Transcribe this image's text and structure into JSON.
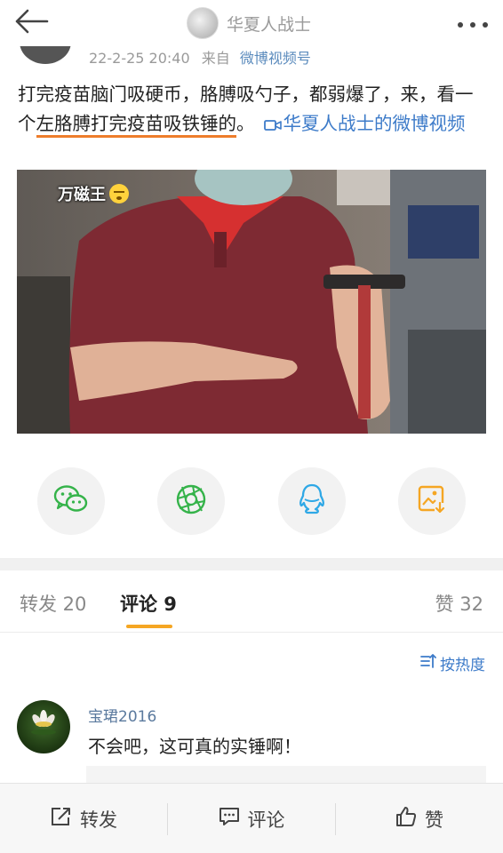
{
  "header": {
    "title": "华夏人战士"
  },
  "post": {
    "meta_time": "22-2-25 20:40",
    "meta_source_prefix": "来自",
    "meta_source": "微博视频号",
    "text_part1": "打完疫苗脑门吸硬币，胳膊吸勺子，都弱爆了，来，看一个",
    "text_underlined": "左胳膊打完疫苗吸铁锤的",
    "text_part2": "。",
    "video_link": "华夏人战士的微博视频",
    "video_caption": "万磁王"
  },
  "share": {
    "items": [
      {
        "name": "wechat",
        "icon": "wechat-icon",
        "color": "#35b34a"
      },
      {
        "name": "moments",
        "icon": "moments-icon",
        "color": "#35b34a"
      },
      {
        "name": "qq",
        "icon": "qq-icon",
        "color": "#2fa8e6"
      },
      {
        "name": "save-image",
        "icon": "save-image-icon",
        "color": "#f5a623"
      }
    ]
  },
  "tabs": {
    "repost": "转发 20",
    "comments": "评论 9",
    "likes": "赞 32"
  },
  "sort": {
    "label": "按热度"
  },
  "comment": {
    "user": "宝珺2016",
    "text": "不会吧，这可真的实锤啊！"
  },
  "bottom_bar": {
    "repost": "转发",
    "comment": "评论",
    "like": "赞"
  },
  "colors": {
    "accent": "#f5a623",
    "link": "#3d7bc9",
    "underline": "#ee7d2b"
  }
}
